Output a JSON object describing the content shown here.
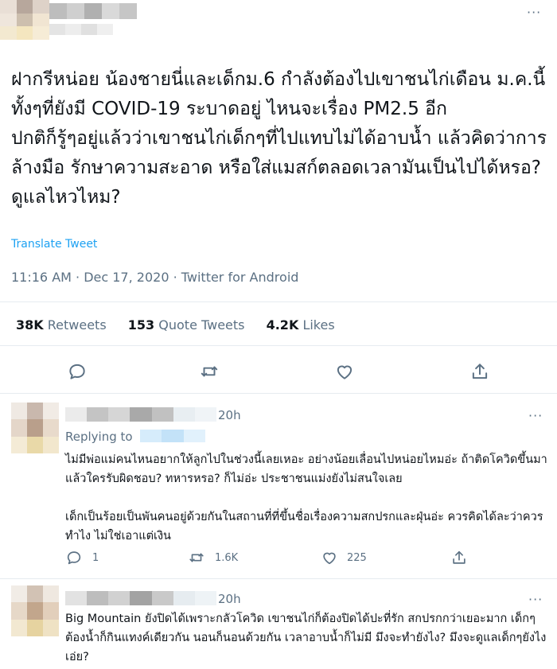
{
  "tweet": {
    "text": "ฝากรีหน่อย น้องชายนี่และเด็กม.6 กำลังต้องไปเขาชนไก่เดือน ม.ค.นี้ ทั้งๆที่ยังมี COVID-19 ระบาดอยู่ ไหนจะเรื่อง PM2.5 อีก\nปกติก็รู้ๆอยู่แล้วว่าเขาชนไก่เด็กๆที่ไปแทบไม่ได้อาบน้ำ แล้วคิดว่าการล้างมือ รักษาความสะอาด หรือใส่แมสก์ตลอดเวลามันเป็นไปได้หรอ? ดูแลไหวไหม?",
    "translate_label": "Translate Tweet",
    "meta": "11:16 AM · Dec 17, 2020 · Twitter for Android",
    "stats": {
      "retweets_count": "38K",
      "retweets_label": "Retweets",
      "quotes_count": "153",
      "quotes_label": "Quote Tweets",
      "likes_count": "4.2K",
      "likes_label": "Likes"
    },
    "more_label": "···"
  },
  "replies": [
    {
      "time": "20h",
      "replying_label": "Replying to",
      "text": "ไม่มีพ่อแม่คนไหนอยากให้ลูกไปในช่วงนี้เลยเหอะ อย่างน้อยเลื่อนไปหน่อยไหมอ่ะ ถ้าติดโควิดขึ้นมาแล้วใครรับผิดชอบ? ทหารหรอ? ก็ไม่อ่ะ ประชาชนแม่งยังไม่สนใจเลย\n\nเด็กเป็นร้อยเป็นพันคนอยู่ด้วยกันในสถานที่ที่ขึ้นชื่อเรื่องความสกปรกและฝุ่นอ่ะ ควรคิดได้ละว่าควรทำไง ไม่ใช่เอาแต่เงิน",
      "reply_count": "1",
      "retweet_count": "1.6K",
      "like_count": "225",
      "more_label": "···"
    },
    {
      "time": "20h",
      "text": "Big Mountain ยังปิดได้เพราะกลัวโควิด เขาชนไก่ก็ต้องปิดได้ปะที่รัก สกปรกกว่าเยอะมาก เด็กๆต้องน้ำก็กินแทงค์เดียวกัน นอนก็นอนด้วยกัน เวลาอาบน้ำก็ไม่มี มึงจะทำยังไง? มึงจะดูแลเด็กๆยังไงเอ่ย?",
      "more_label": "···"
    }
  ],
  "colors": {
    "text": "#0f1419",
    "muted": "#5b7083",
    "link": "#1da1f2",
    "divider": "#e6ecf0"
  },
  "icons": [
    "reply-icon",
    "retweet-icon",
    "like-icon",
    "share-icon"
  ]
}
